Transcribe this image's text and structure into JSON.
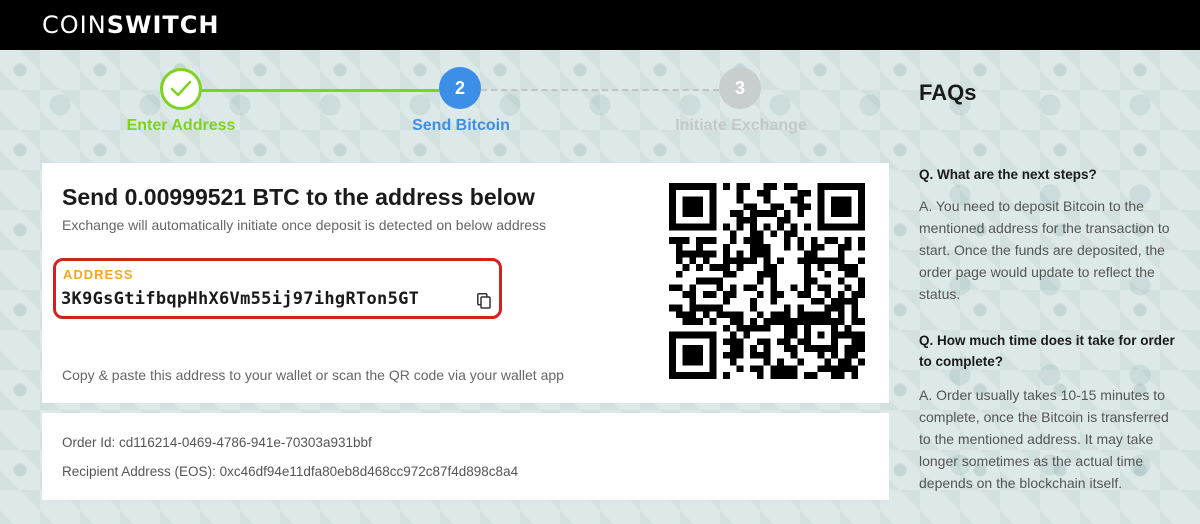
{
  "brand": {
    "logo_prefix": "COIN",
    "logo_suffix": "SWITCH"
  },
  "stepper": {
    "steps": [
      {
        "number": "",
        "label": "Enter Address",
        "status": "complete"
      },
      {
        "number": "2",
        "label": "Send Bitcoin",
        "status": "active"
      },
      {
        "number": "3",
        "label": "Initiate Exchange",
        "status": "pending"
      }
    ]
  },
  "deposit": {
    "title": "Send 0.00999521 BTC to the address below",
    "subtitle": "Exchange will automatically initiate once deposit is detected on below address",
    "address_label": "ADDRESS",
    "address": "3K9GsGtifbqpHhX6Vm55ij97ihgRTon5GT",
    "copy_hint": "Copy & paste this address to your wallet or scan the QR code via your wallet app"
  },
  "order": {
    "order_id": "Order Id: cd116214-0469-4786-941e-70303a931bbf",
    "recipient": "Recipient Address (EOS): 0xc46df94e11dfa80eb8d468cc972c87f4d898c8a4"
  },
  "faq": {
    "title": "FAQs",
    "items": [
      {
        "question": "Q. What are the next steps?",
        "answer": "A. You need to deposit Bitcoin to the mentioned address for the transaction to start. Once the funds are deposited, the order page would update to reflect the status."
      },
      {
        "question": "Q. How much time does it take for order to complete?",
        "answer": "A. Order usually takes 10-15 minutes to complete, once the Bitcoin is transferred to the mentioned address. It may take longer sometimes as the actual time depends on the blockchain itself."
      }
    ]
  },
  "colors": {
    "complete": "#7ed321",
    "active": "#3d8ee6",
    "pending": "#c8cdcd",
    "address_label": "#f5a623",
    "highlight_border": "#d62020"
  }
}
